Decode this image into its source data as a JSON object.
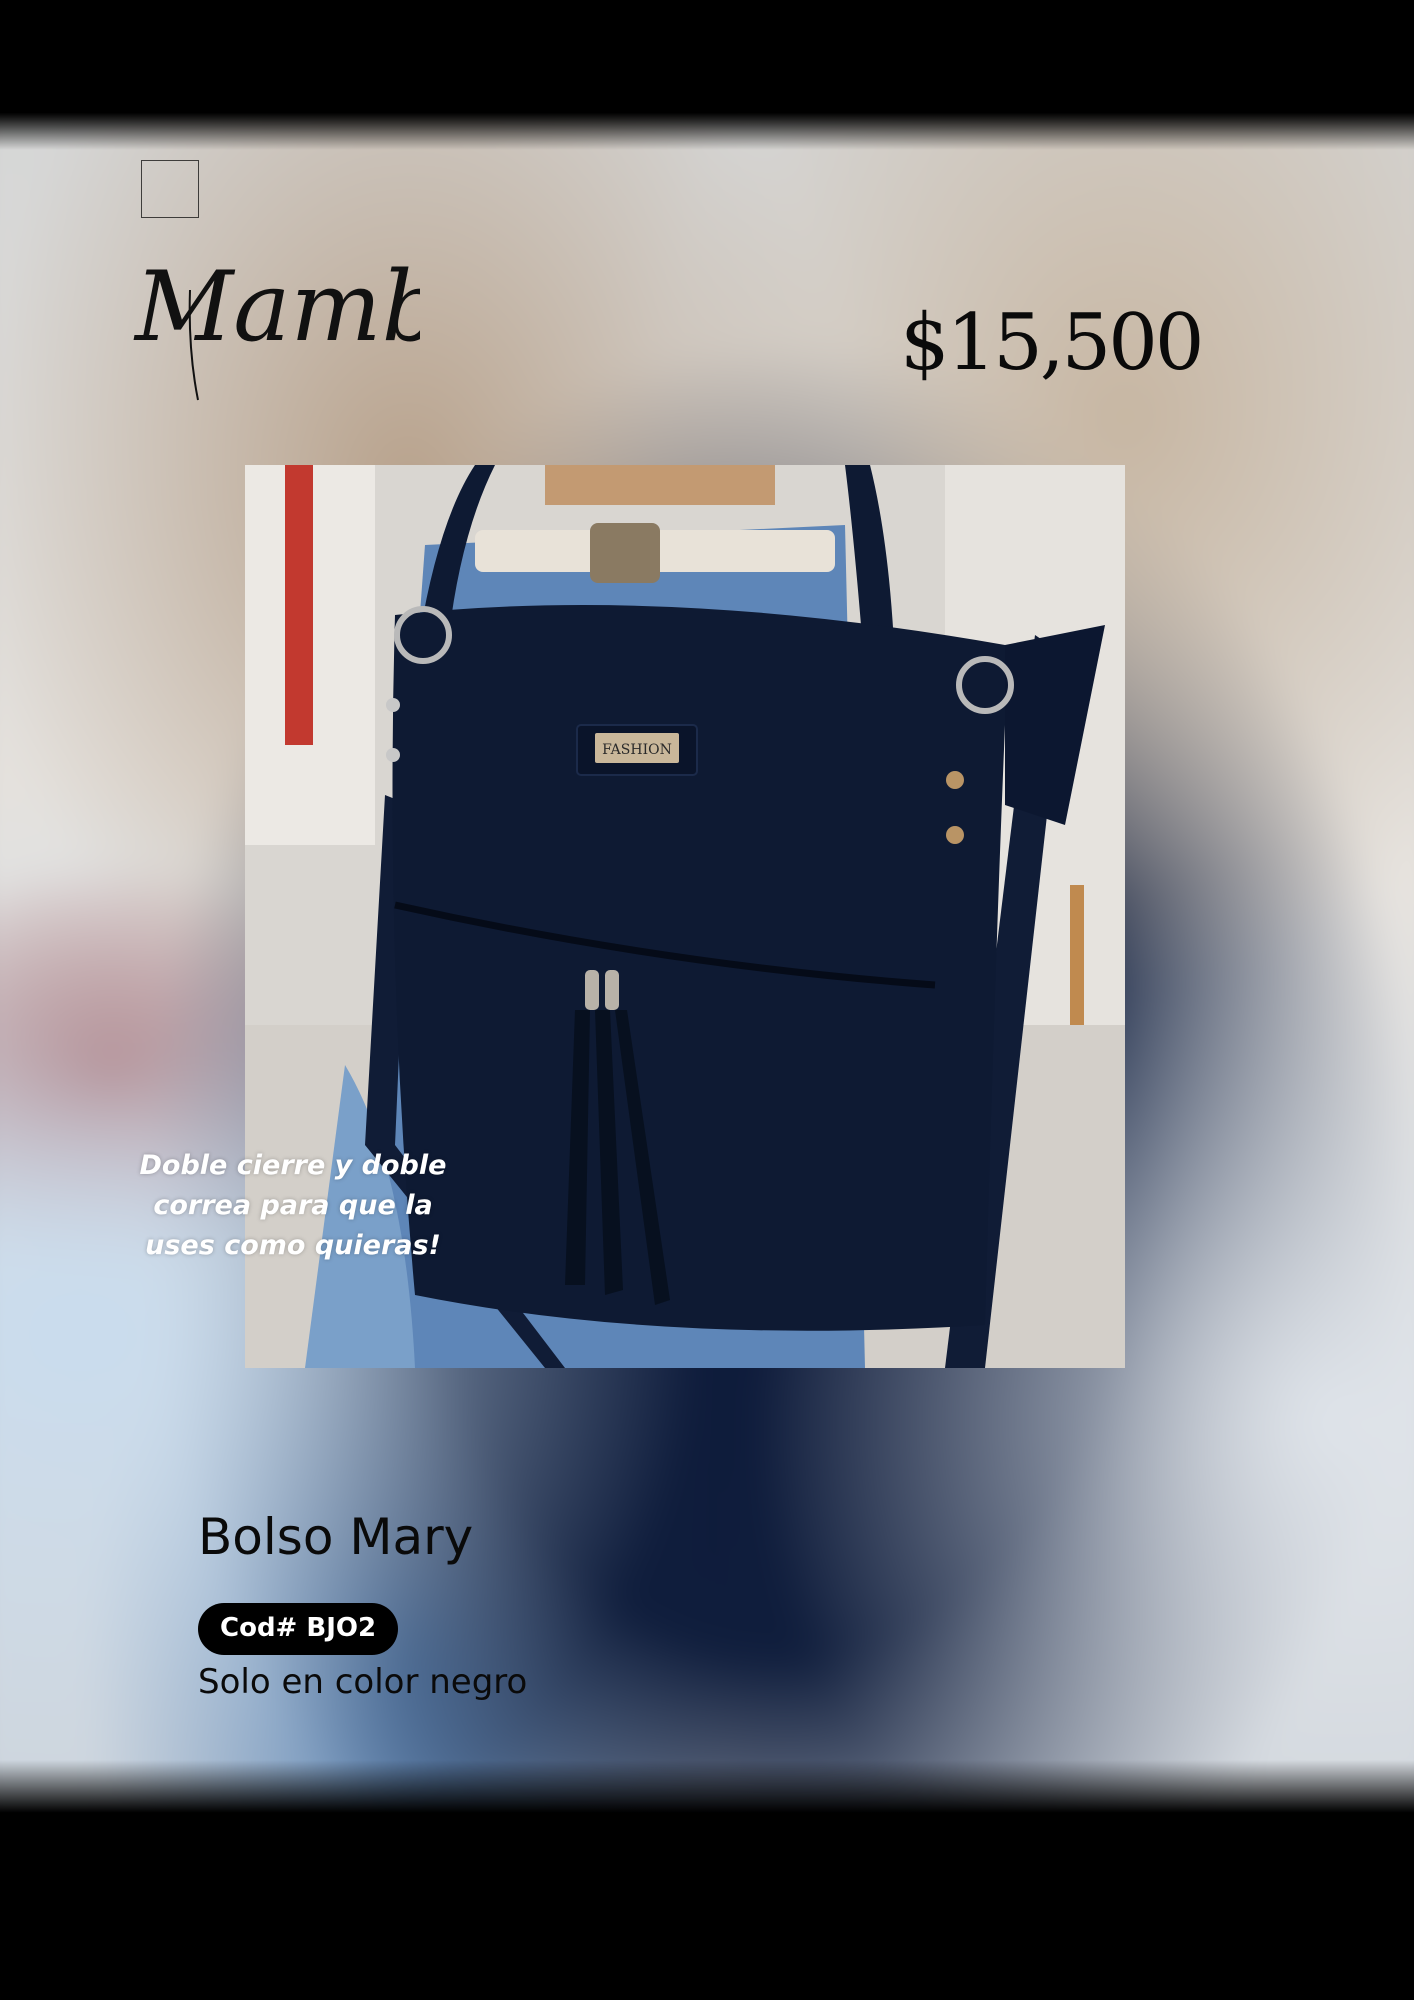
{
  "brand": {
    "name": "Mamba"
  },
  "price": "$15,500",
  "photo": {
    "caption_lines": [
      "Doble cierre y doble",
      "correa para que la",
      "uses como quieras!"
    ],
    "bag_tag": "FASHION",
    "bag_color": "#0e1a33"
  },
  "product": {
    "title": "Bolso Mary",
    "code": "Cod# BJO2",
    "note": "Solo en color negro"
  },
  "colors": {
    "background": "#000000",
    "text": "#0a0a0a",
    "badge": "#000000"
  }
}
